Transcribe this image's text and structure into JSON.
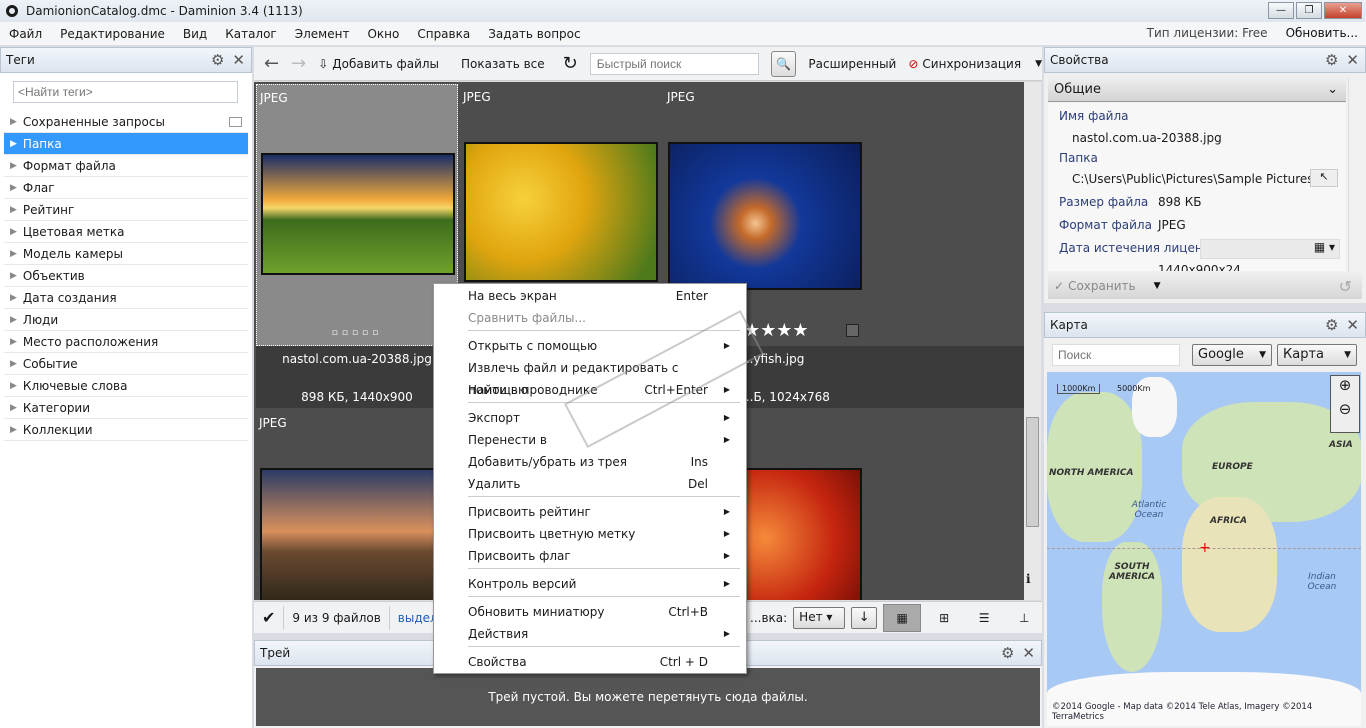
{
  "window": {
    "title": "DamionionCatalog.dmc - Daminion 3.4 (1113)",
    "controls": [
      "minimize",
      "maximize",
      "close"
    ]
  },
  "menu": {
    "items": [
      "Файл",
      "Редактирование",
      "Вид",
      "Каталог",
      "Элемент",
      "Окно",
      "Справка",
      "Задать вопрос"
    ],
    "license": "Тип лицензии: Free",
    "update": "Обновить..."
  },
  "tags": {
    "title": "Теги",
    "search_placeholder": "<Найти теги>",
    "items": [
      {
        "label": "Сохраненные запросы"
      },
      {
        "label": "Папка",
        "selected": true
      },
      {
        "label": "Формат файла"
      },
      {
        "label": "Флаг"
      },
      {
        "label": "Рейтинг"
      },
      {
        "label": "Цветовая метка"
      },
      {
        "label": "Модель камеры"
      },
      {
        "label": "Объектив"
      },
      {
        "label": "Дата создания"
      },
      {
        "label": "Люди"
      },
      {
        "label": "Место расположения"
      },
      {
        "label": "Событие"
      },
      {
        "label": "Ключевые слова"
      },
      {
        "label": "Категории"
      },
      {
        "label": "Коллекции"
      }
    ]
  },
  "toolbar": {
    "add_files": "Добавить файлы",
    "show_all": "Показать все",
    "quick_search_placeholder": "Быстрый поиск",
    "advanced": "Расширенный",
    "sync": "Синхронизация"
  },
  "grid": {
    "items": [
      {
        "format": "JPEG",
        "name": "nastol.com.ua-20388.jpg",
        "info": "898 КБ, 1440x900",
        "selected": true
      },
      {
        "format": "JPEG",
        "name": "",
        "info": ""
      },
      {
        "format": "JPEG",
        "name": "...yfish.jpg",
        "info": "...Б, 1024x768",
        "rating": "★★★★"
      },
      {
        "format": "JPEG"
      }
    ]
  },
  "bottombar": {
    "count": "9 из 9 файлов",
    "selected": "выделен",
    "sort_label": "...вка:",
    "sort_value": "Нет"
  },
  "tray": {
    "title": "Трей",
    "empty": "Трей пустой. Вы можете перетянуть сюда файлы."
  },
  "properties": {
    "title": "Свойства",
    "section": "Общие",
    "file_name_label": "Имя файла",
    "file_name": "nastol.com.ua-20388.jpg",
    "folder_label": "Папка",
    "folder": "C:\\Users\\Public\\Pictures\\Sample Pictures",
    "size_label": "Размер файла",
    "size": "898 КБ",
    "format_label": "Формат файла",
    "format": "JPEG",
    "license_label": "Дата истечения лицензии",
    "partial_value": "1440x900x24",
    "save": "Сохранить"
  },
  "map": {
    "title": "Карта",
    "search_placeholder": "Поиск",
    "provider": "Google",
    "type": "Карта",
    "scale": [
      "1000Km",
      "5000Km"
    ],
    "labels": [
      "NORTH AMERICA",
      "EUROPE",
      "ASIA",
      "AFRICA",
      "SOUTH AMERICA",
      "Atlantic Ocean",
      "Indian Ocean"
    ],
    "copyright": "©2014 Google - Map data ©2014 Tele Atlas, Imagery ©2014 TerraMetrics"
  },
  "context_menu": {
    "items": [
      {
        "label": "На весь экран",
        "shortcut": "Enter"
      },
      {
        "label": "Сравнить файлы...",
        "disabled": true
      },
      {
        "label": "Открыть с помощью",
        "submenu": true
      },
      {
        "label": "Извлечь файл и редактировать с помощью",
        "submenu": true
      },
      {
        "label": "Найти в проводнике",
        "shortcut": "Ctrl+Enter"
      },
      {
        "label": "Экспорт",
        "submenu": true
      },
      {
        "label": "Перенести в",
        "submenu": true
      },
      {
        "label": "Добавить/убрать из трея",
        "shortcut": "Ins"
      },
      {
        "label": "Удалить",
        "shortcut": "Del"
      },
      {
        "label": "Присвоить рейтинг",
        "submenu": true
      },
      {
        "label": "Присвоить цветную метку",
        "submenu": true
      },
      {
        "label": "Присвоить флаг",
        "submenu": true
      },
      {
        "label": "Контроль версий",
        "submenu": true
      },
      {
        "label": "Обновить миниатюру",
        "shortcut": "Ctrl+B"
      },
      {
        "label": "Действия",
        "submenu": true
      },
      {
        "label": "Свойства",
        "shortcut": "Ctrl + D"
      }
    ]
  },
  "colors": {
    "selection": "#3399ff",
    "grid_bg": "#4d4d4d",
    "label_blue": "#2b3d7a"
  }
}
